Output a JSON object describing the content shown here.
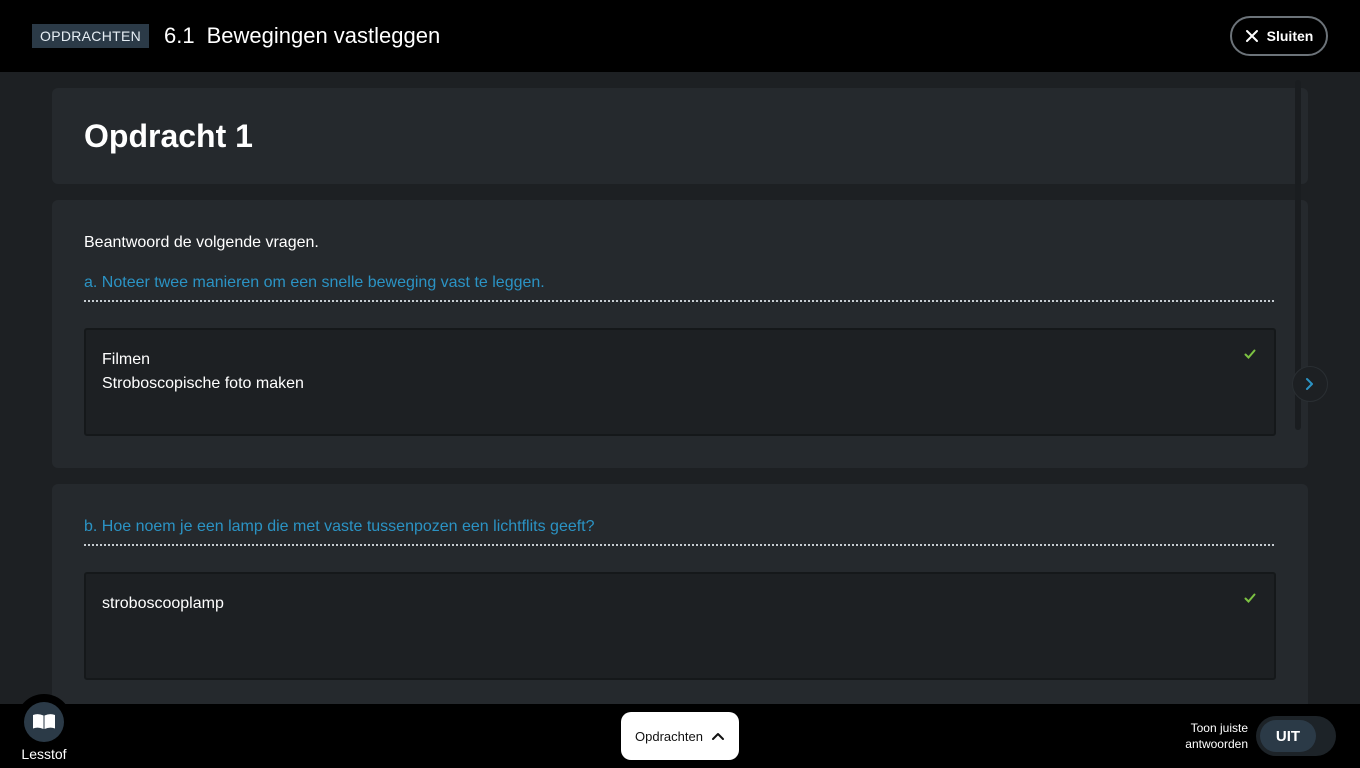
{
  "header": {
    "tag": "OPDRACHTEN",
    "section_number": "6.1",
    "section_title": "Bewegingen vastleggen",
    "close_label": "Sluiten"
  },
  "assignment": {
    "title": "Opdracht 1",
    "intro": "Beantwoord de volgende vragen.",
    "questions": [
      {
        "text": "a. Noteer twee manieren om een snelle beweging vast te leggen.",
        "answer_lines": [
          "Filmen",
          "Stroboscopische foto maken"
        ],
        "status": "correct"
      },
      {
        "text": "b. Hoe noem je een lamp die met vaste tussenpozen een lichtflits geeft?",
        "answer_lines": [
          "stroboscooplamp"
        ],
        "status": "correct"
      }
    ]
  },
  "footer": {
    "lesstof_label": "Lesstof",
    "opdrachten_label": "Opdrachten",
    "toggle_label_line1": "Toon juiste",
    "toggle_label_line2": "antwoorden",
    "toggle_value": "UIT"
  },
  "colors": {
    "question_blue": "#2b93c4",
    "check_green": "#7cc242",
    "tag_bg": "#2b3a47"
  },
  "icons": {
    "close": "close-icon",
    "check": "check-icon",
    "next": "chevron-right-icon",
    "book": "book-icon",
    "chevron_up": "chevron-up-icon"
  }
}
